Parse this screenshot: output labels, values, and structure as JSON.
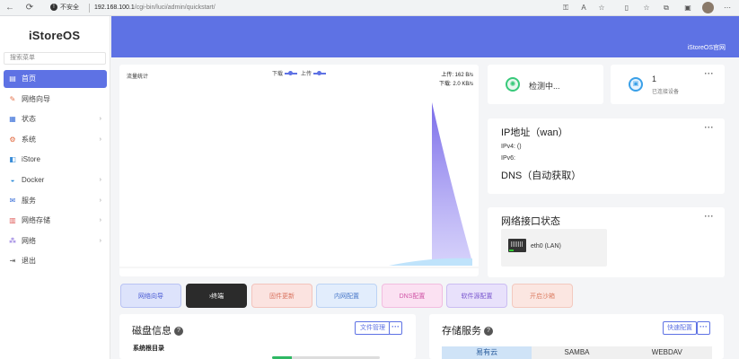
{
  "browser": {
    "security_label": "不安全",
    "url_host": "192.168.100.1",
    "url_path": "/cgi-bin/luci/admin/quickstart/"
  },
  "sidebar": {
    "logo": "iStoreOS",
    "search_placeholder": "搜索菜单",
    "items": [
      {
        "label": "首页",
        "icon": "home-icon",
        "active": true
      },
      {
        "label": "网络向导",
        "icon": "wizard-icon",
        "has_children": false
      },
      {
        "label": "状态",
        "icon": "status-icon",
        "has_children": true
      },
      {
        "label": "系统",
        "icon": "gear-icon",
        "has_children": true
      },
      {
        "label": "iStore",
        "icon": "store-icon",
        "has_children": false
      },
      {
        "label": "Docker",
        "icon": "docker-icon",
        "has_children": true
      },
      {
        "label": "服务",
        "icon": "service-icon",
        "has_children": true
      },
      {
        "label": "网络存储",
        "icon": "storage-icon",
        "has_children": true
      },
      {
        "label": "网络",
        "icon": "network-icon",
        "has_children": true
      },
      {
        "label": "退出",
        "icon": "logout-icon",
        "has_children": false
      }
    ]
  },
  "header": {
    "title": "iStoreOS官网"
  },
  "traffic": {
    "title": "流量统计",
    "legend_down": "下载",
    "legend_up": "上传",
    "upload_rate": "上传: 162 B/s",
    "download_rate": "下载: 2.0 KB/s"
  },
  "status_card": {
    "text": "检测中..."
  },
  "devices_card": {
    "count": "1",
    "label": "已连接设备"
  },
  "ip_card": {
    "title": "IP地址（wan）",
    "ipv4": "IPv4:   ()",
    "ipv6": "IPv6:",
    "dns": "DNS（自动获取）"
  },
  "iface_card": {
    "title": "网络接口状态",
    "interface": "eth0 (LAN)"
  },
  "more_label": "···",
  "quick_buttons": [
    {
      "label": "网络向导",
      "bg": "#dde3fb",
      "border": "#b9c3f3",
      "color": "#4a5bd4"
    },
    {
      "label": "›终端",
      "bg": "#2b2b2b",
      "border": "#2b2b2b",
      "color": "#ffffff"
    },
    {
      "label": "固件更新",
      "bg": "#fbe3e0",
      "border": "#f3c4bd",
      "color": "#d9735f"
    },
    {
      "label": "内网配置",
      "bg": "#e2edfc",
      "border": "#bcd3f4",
      "color": "#4a79c9"
    },
    {
      "label": "DNS配置",
      "bg": "#fbe1f2",
      "border": "#f2bde0",
      "color": "#d156a7"
    },
    {
      "label": "软件源配置",
      "bg": "#e8e1fb",
      "border": "#cbbdf2",
      "color": "#7a58cf"
    },
    {
      "label": "开启沙箱",
      "bg": "#fbe6e1",
      "border": "#f3c9bf",
      "color": "#dd8066"
    }
  ],
  "disk_card": {
    "title": "磁盘信息",
    "manage_label": "文件管理",
    "sub": "系统根目录",
    "usage": 0.18
  },
  "storage_card": {
    "title": "存储服务",
    "quick_label": "快速配置",
    "tabs": [
      "易有云",
      "SAMBA",
      "WEBDAV"
    ]
  },
  "colors": {
    "accent": "#5e72e4",
    "chart_fill": "#7b69f0"
  }
}
